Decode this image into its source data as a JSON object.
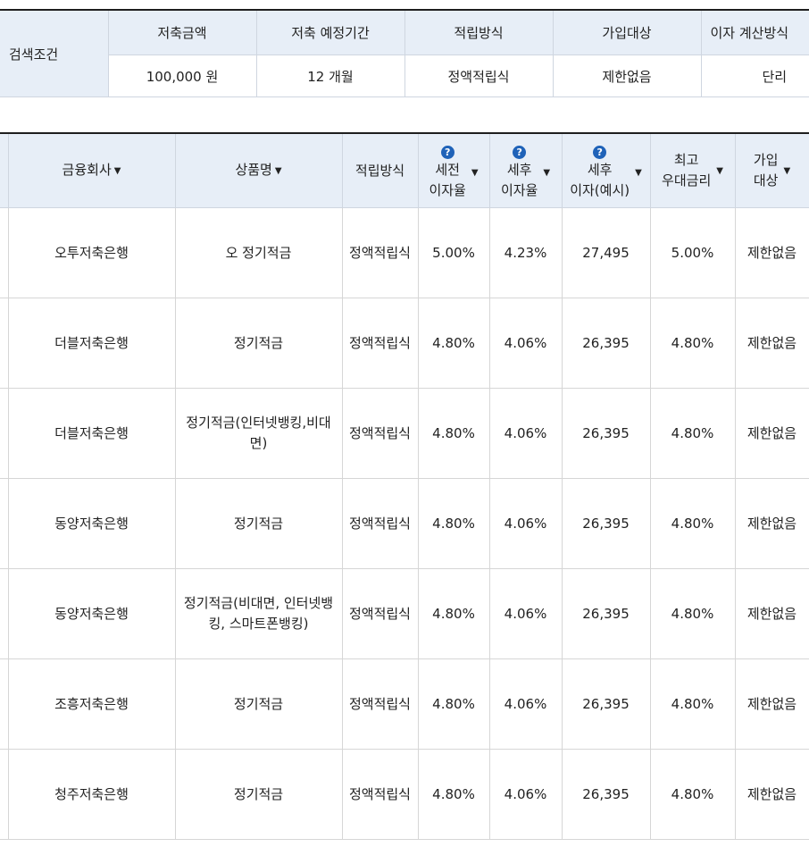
{
  "conditions": {
    "label": "검색조건",
    "headers": [
      "저축금액",
      "저축 예정기간",
      "적립방식",
      "가입대상",
      "이자 계산방식"
    ],
    "values": [
      "100,000 원",
      "12 개월",
      "정액적립식",
      "제한없음",
      "단리"
    ]
  },
  "results": {
    "headers": {
      "company": "금융회사",
      "product": "상품명",
      "method": "적립방식",
      "pre_tax_1": "세전",
      "pre_tax_2": "이자율",
      "post_tax_1": "세후",
      "post_tax_2": "이자율",
      "interest_1": "세후",
      "interest_2": "이자(예시)",
      "max_1": "최고",
      "max_2": "우대금리",
      "target_1": "가입",
      "target_2": "대상"
    },
    "help_icon": "question-icon",
    "sort_icon": "▼",
    "rows": [
      {
        "company": "오투저축은행",
        "product": "오 정기적금",
        "method": "정액적립식",
        "pre": "5.00%",
        "post": "4.23%",
        "interest": "27,495",
        "max": "5.00%",
        "target": "제한없음"
      },
      {
        "company": "더블저축은행",
        "product": "정기적금",
        "method": "정액적립식",
        "pre": "4.80%",
        "post": "4.06%",
        "interest": "26,395",
        "max": "4.80%",
        "target": "제한없음"
      },
      {
        "company": "더블저축은행",
        "product": "정기적금(인터넷뱅킹,비대면)",
        "method": "정액적립식",
        "pre": "4.80%",
        "post": "4.06%",
        "interest": "26,395",
        "max": "4.80%",
        "target": "제한없음"
      },
      {
        "company": "동양저축은행",
        "product": "정기적금",
        "method": "정액적립식",
        "pre": "4.80%",
        "post": "4.06%",
        "interest": "26,395",
        "max": "4.80%",
        "target": "제한없음"
      },
      {
        "company": "동양저축은행",
        "product": "정기적금(비대면, 인터넷뱅킹, 스마트폰뱅킹)",
        "method": "정액적립식",
        "pre": "4.80%",
        "post": "4.06%",
        "interest": "26,395",
        "max": "4.80%",
        "target": "제한없음"
      },
      {
        "company": "조흥저축은행",
        "product": "정기적금",
        "method": "정액적립식",
        "pre": "4.80%",
        "post": "4.06%",
        "interest": "26,395",
        "max": "4.80%",
        "target": "제한없음"
      },
      {
        "company": "청주저축은행",
        "product": "정기적금",
        "method": "정액적립식",
        "pre": "4.80%",
        "post": "4.06%",
        "interest": "26,395",
        "max": "4.80%",
        "target": "제한없음"
      }
    ]
  }
}
